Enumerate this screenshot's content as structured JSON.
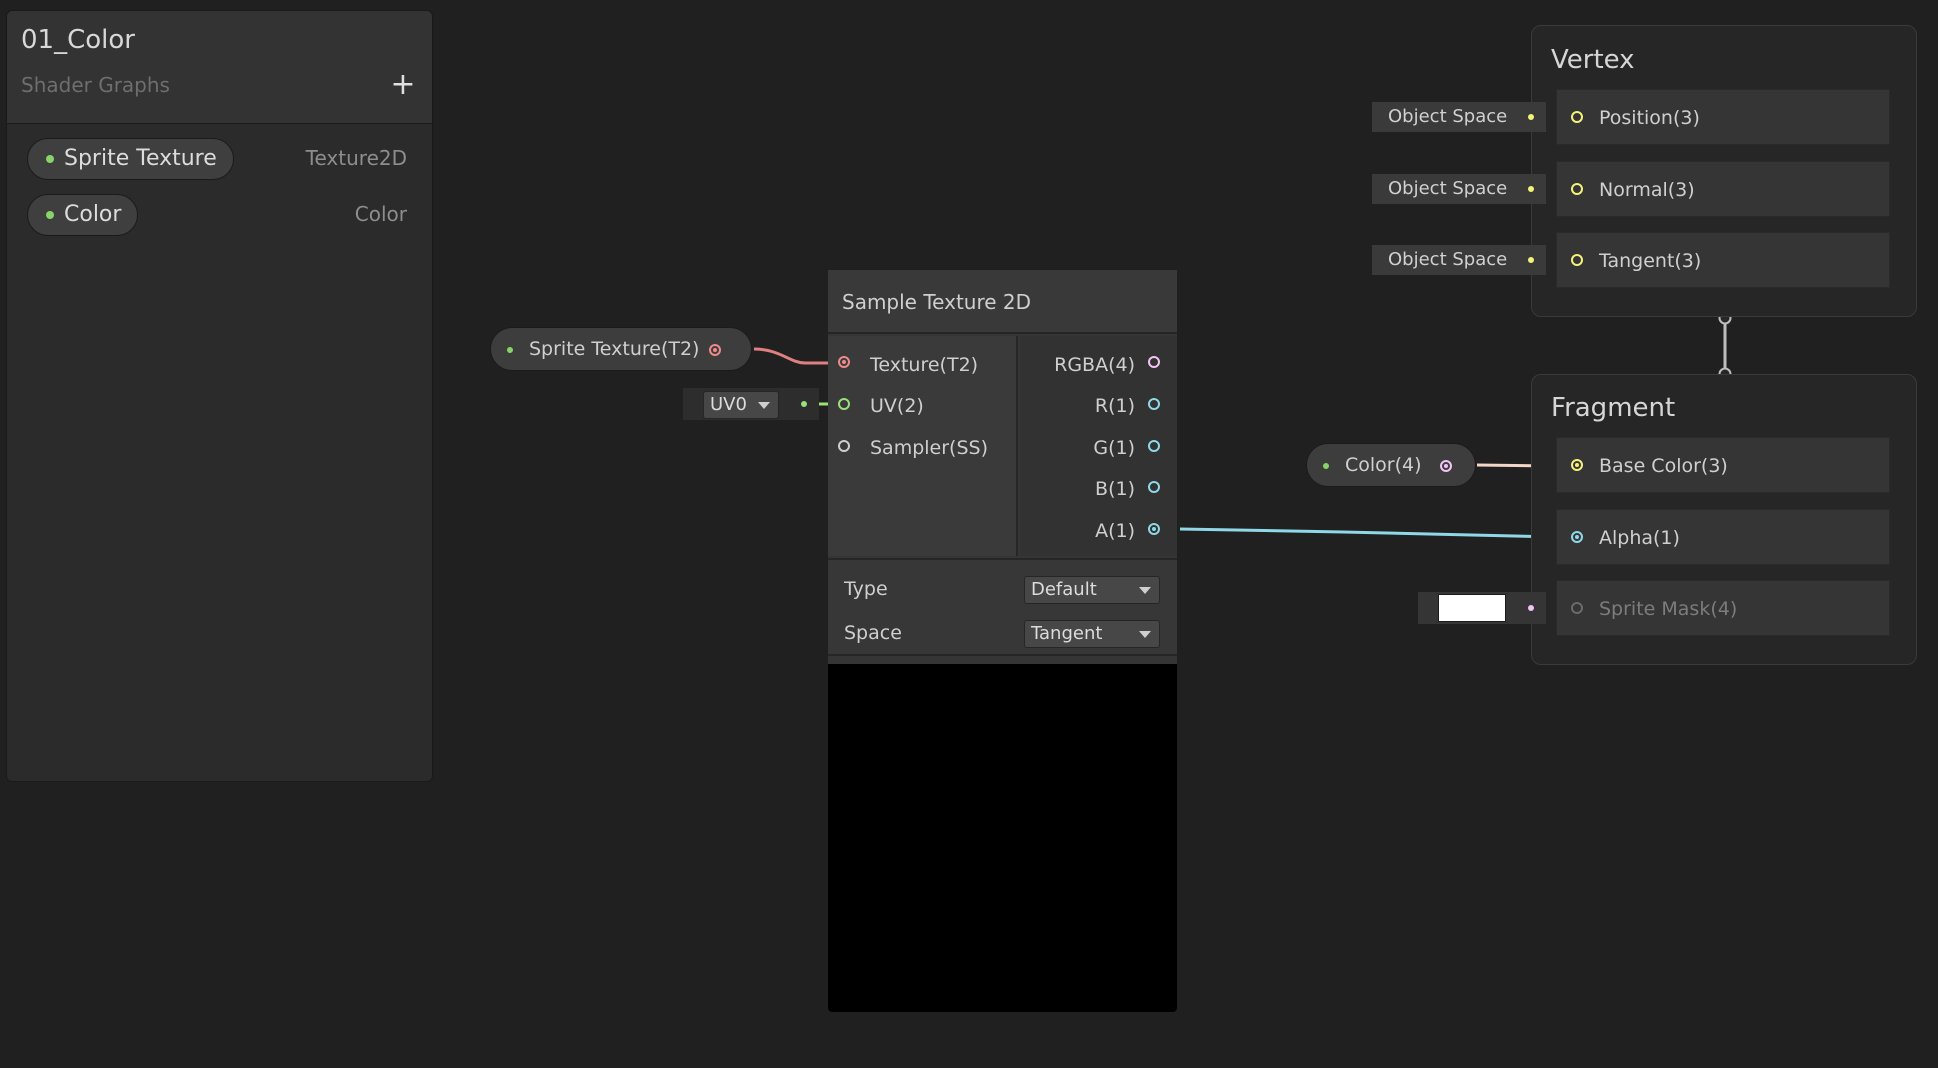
{
  "blackboard": {
    "title": "01_Color",
    "subtitle": "Shader Graphs",
    "add_label": "+",
    "properties": [
      {
        "name": "Sprite Texture",
        "type": "Texture2D"
      },
      {
        "name": "Color",
        "type": "Color"
      }
    ]
  },
  "nodes": {
    "sprite_texture_prop": {
      "label": "Sprite Texture(T2)"
    },
    "color_prop": {
      "label": "Color(4)"
    },
    "uv_value": "UV0",
    "sample_texture": {
      "title": "Sample Texture 2D",
      "inputs": [
        "Texture(T2)",
        "UV(2)",
        "Sampler(SS)"
      ],
      "outputs": [
        "RGBA(4)",
        "R(1)",
        "G(1)",
        "B(1)",
        "A(1)"
      ],
      "controls": [
        {
          "label": "Type",
          "value": "Default"
        },
        {
          "label": "Space",
          "value": "Tangent"
        }
      ]
    }
  },
  "vertex": {
    "title": "Vertex",
    "space_label": "Object Space",
    "blocks": [
      "Position(3)",
      "Normal(3)",
      "Tangent(3)"
    ]
  },
  "fragment": {
    "title": "Fragment",
    "blocks": [
      "Base Color(3)",
      "Alpha(1)",
      "Sprite Mask(4)"
    ]
  },
  "colors": {
    "texture_port": "#f08a8a",
    "vector2_port": "#9be07a",
    "vector3_port": "#f4f27a",
    "vector4_port": "#f4c2f4",
    "float_port": "#8fd8e8",
    "property_dot": "#8ad36a"
  }
}
